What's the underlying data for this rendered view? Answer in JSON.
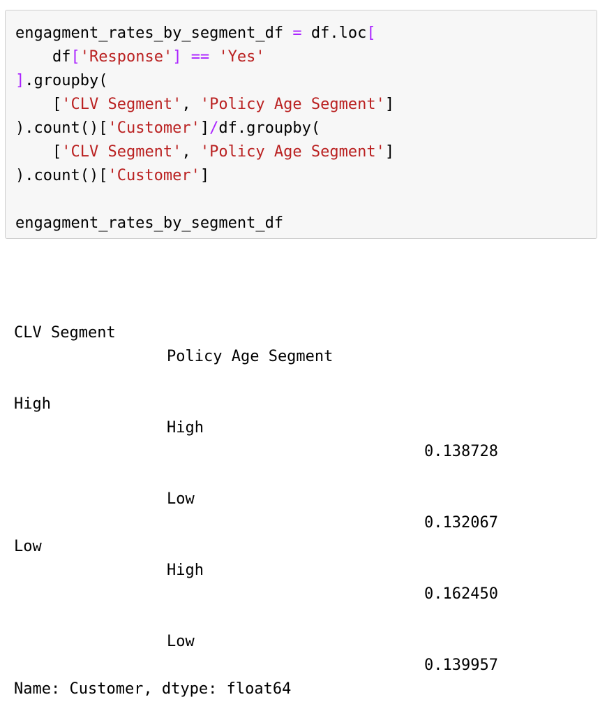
{
  "code_cell": {
    "lines": [
      [
        {
          "t": "engagment_rates_by_segment_df ",
          "k": "plain"
        },
        {
          "t": "=",
          "k": "op"
        },
        {
          "t": " df.loc",
          "k": "plain"
        },
        {
          "t": "[",
          "k": "op"
        }
      ],
      [
        {
          "t": "    df",
          "k": "plain"
        },
        {
          "t": "[",
          "k": "op"
        },
        {
          "t": "'Response'",
          "k": "str"
        },
        {
          "t": "] ",
          "k": "op"
        },
        {
          "t": "==",
          "k": "op"
        },
        {
          "t": " ",
          "k": "plain"
        },
        {
          "t": "'Yes'",
          "k": "str"
        }
      ],
      [
        {
          "t": "]",
          "k": "op"
        },
        {
          "t": ".groupby(",
          "k": "plain"
        }
      ],
      [
        {
          "t": "    [",
          "k": "plain"
        },
        {
          "t": "'CLV Segment'",
          "k": "str"
        },
        {
          "t": ", ",
          "k": "plain"
        },
        {
          "t": "'Policy Age Segment'",
          "k": "str"
        },
        {
          "t": "]",
          "k": "plain"
        }
      ],
      [
        {
          "t": ").count()[",
          "k": "plain"
        },
        {
          "t": "'Customer'",
          "k": "str"
        },
        {
          "t": "]",
          "k": "plain"
        },
        {
          "t": "/",
          "k": "op"
        },
        {
          "t": "df.groupby(",
          "k": "plain"
        }
      ],
      [
        {
          "t": "    [",
          "k": "plain"
        },
        {
          "t": "'CLV Segment'",
          "k": "str"
        },
        {
          "t": ", ",
          "k": "plain"
        },
        {
          "t": "'Policy Age Segment'",
          "k": "str"
        },
        {
          "t": "]",
          "k": "plain"
        }
      ],
      [
        {
          "t": ").count()[",
          "k": "plain"
        },
        {
          "t": "'Customer'",
          "k": "str"
        },
        {
          "t": "]",
          "k": "plain"
        }
      ],
      [
        {
          "t": "",
          "k": "plain"
        }
      ],
      [
        {
          "t": "engagment_rates_by_segment_df",
          "k": "plain"
        }
      ]
    ]
  },
  "output": {
    "headers": {
      "clv": "CLV Segment",
      "policy_age": "Policy Age Segment"
    },
    "rows": [
      {
        "clv": "High",
        "policy_age": "High",
        "value": "0.138728"
      },
      {
        "clv": "",
        "policy_age": "Low",
        "value": "0.132067"
      },
      {
        "clv": "Low",
        "policy_age": "High",
        "value": "0.162450"
      },
      {
        "clv": "",
        "policy_age": "Low",
        "value": "0.139957"
      }
    ],
    "footer": "Name: Customer, dtype: float64"
  },
  "colors": {
    "string": "#ba2121",
    "operator": "#aa22ff",
    "cell_background": "#f7f7f7",
    "cell_border": "#cfcfcf"
  }
}
